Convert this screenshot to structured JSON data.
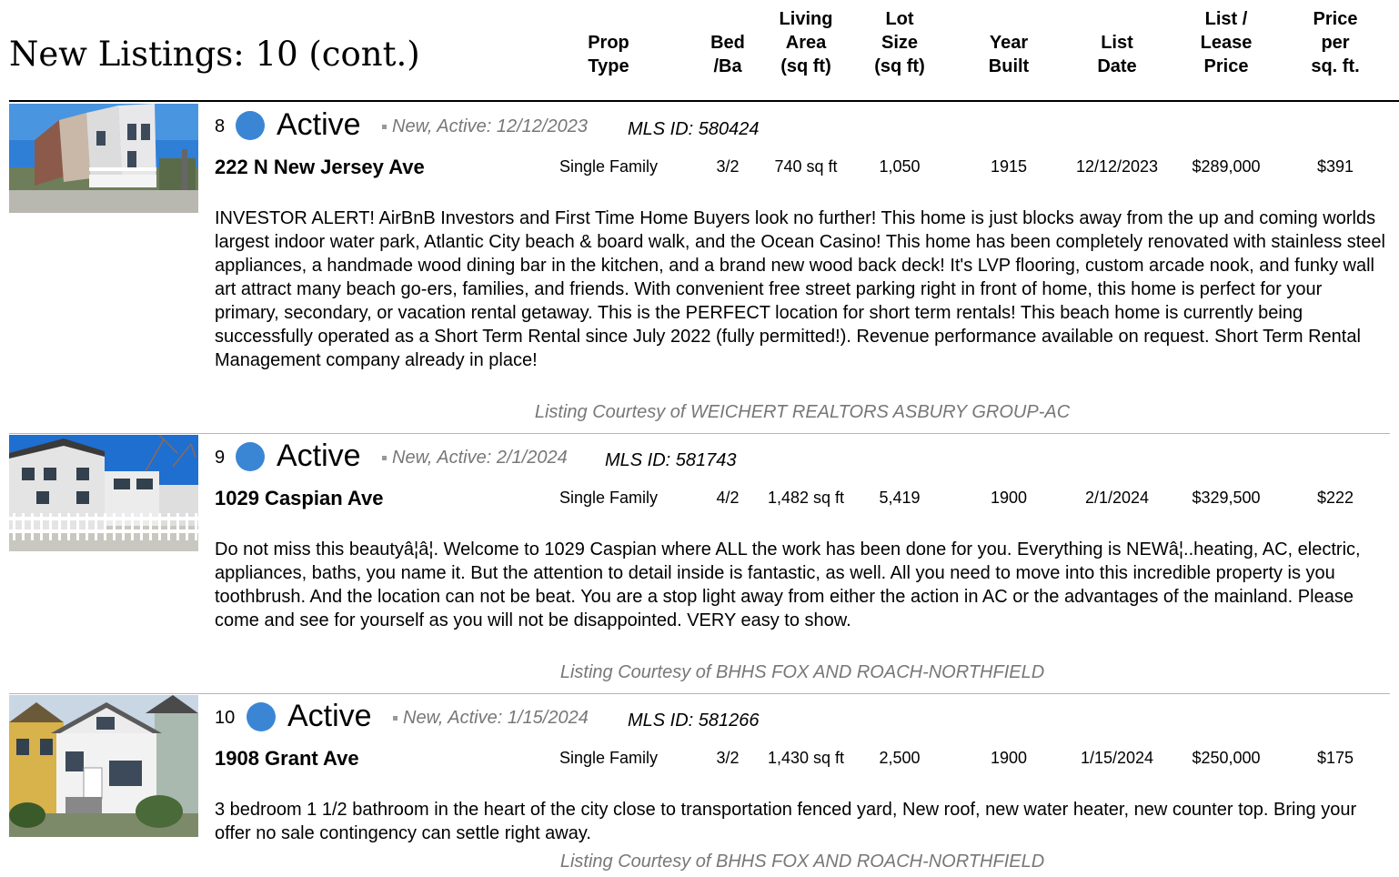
{
  "header": {
    "title": "New Listings: 10 (cont.)",
    "columns": [
      [
        "Prop",
        "Type"
      ],
      [
        "Bed",
        "/Ba"
      ],
      [
        "Living",
        "Area",
        "(sq ft)"
      ],
      [
        "Lot",
        "Size",
        "(sq ft)"
      ],
      [
        "Year",
        "Built"
      ],
      [
        "List",
        "Date"
      ],
      [
        "List /",
        "Lease",
        "Price"
      ],
      [
        "Price",
        "per",
        "sq. ft."
      ]
    ]
  },
  "colors": {
    "status_dot": "#3a86d4",
    "muted_text": "#777777"
  },
  "listings": [
    {
      "number": "8",
      "status": "Active",
      "new_tag": "New, Active: 12/12/2023",
      "mls": "MLS ID: 580424",
      "address": "222 N New Jersey Ave",
      "prop_type": "Single Family",
      "bed_ba": "3/2",
      "living_area": "740 sq ft",
      "lot_size": "1,050",
      "year_built": "1915",
      "list_date": "12/12/2023",
      "price": "$289,000",
      "price_per_sqft": "$391",
      "description": "INVESTOR ALERT! AirBnB Investors and First Time Home Buyers look no further! This home is just blocks away from the up and coming worlds largest indoor water park, Atlantic City beach & board walk, and the Ocean Casino! This home has been completely renovated with stainless steel appliances, a handmade wood dining bar in the kitchen, and a brand new wood back deck! It's LVP flooring, custom arcade nook, and funky wall art attract many beach go-ers, families, and friends. With convenient free street parking right in front of home, this home is perfect for your primary, secondary, or vacation rental getaway. This is the PERFECT location for short term rentals! This beach home is currently being successfully operated as a Short Term Rental since July 2022 (fully permitted!). Revenue performance available on request. Short Term Rental Management company already in place!",
      "courtesy": "Listing Courtesy of WEICHERT REALTORS ASBURY GROUP-AC"
    },
    {
      "number": "9",
      "status": "Active",
      "new_tag": "New, Active: 2/1/2024",
      "mls": "MLS ID: 581743",
      "address": "1029 Caspian Ave",
      "prop_type": "Single Family",
      "bed_ba": "4/2",
      "living_area": "1,482 sq ft",
      "lot_size": "5,419",
      "year_built": "1900",
      "list_date": "2/1/2024",
      "price": "$329,500",
      "price_per_sqft": "$222",
      "description": "Do not miss this beautyâ¦â¦. Welcome to 1029 Caspian where ALL the work has been done for you. Everything is NEWâ¦..heating, AC, electric, appliances, baths, you name it. But the attention to detail inside is fantastic, as well. All you need to move into this incredible property is you toothbrush. And the location can not be beat. You are a stop light away from either the action in AC or the advantages of the mainland. Please come and see for yourself as you will not be disappointed. VERY easy to show.",
      "courtesy": "Listing Courtesy of BHHS FOX AND ROACH-NORTHFIELD"
    },
    {
      "number": "10",
      "status": "Active",
      "new_tag": "New, Active: 1/15/2024",
      "mls": "MLS ID: 581266",
      "address": "1908 Grant Ave",
      "prop_type": "Single Family",
      "bed_ba": "3/2",
      "living_area": "1,430 sq ft",
      "lot_size": "2,500",
      "year_built": "1900",
      "list_date": "1/15/2024",
      "price": "$250,000",
      "price_per_sqft": "$175",
      "description": "3 bedroom 1 1/2 bathroom in the heart of the city close to transportation fenced yard, New roof, new water heater, new counter top. Bring your offer no sale contingency can settle right away.",
      "courtesy": "Listing Courtesy of BHHS FOX AND ROACH-NORTHFIELD"
    }
  ]
}
